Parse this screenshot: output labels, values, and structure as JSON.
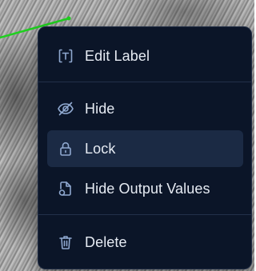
{
  "colors": {
    "menu_background": "#0b1528",
    "menu_border": "#1f2c44",
    "active_item_background": "#1b2a44",
    "text": "#e6ebf3",
    "icon": "#8fa8cf",
    "annotation_line": "#1fd11f"
  },
  "context_menu": {
    "items": [
      {
        "label": "Edit Label",
        "icon": "text-box-icon"
      },
      {
        "label": "Hide",
        "icon": "eye-off-icon"
      },
      {
        "label": "Lock",
        "icon": "lock-icon",
        "active": true
      },
      {
        "label": "Hide Output Values",
        "icon": "file-eye-icon"
      },
      {
        "label": "Delete",
        "icon": "trash-icon"
      }
    ]
  }
}
